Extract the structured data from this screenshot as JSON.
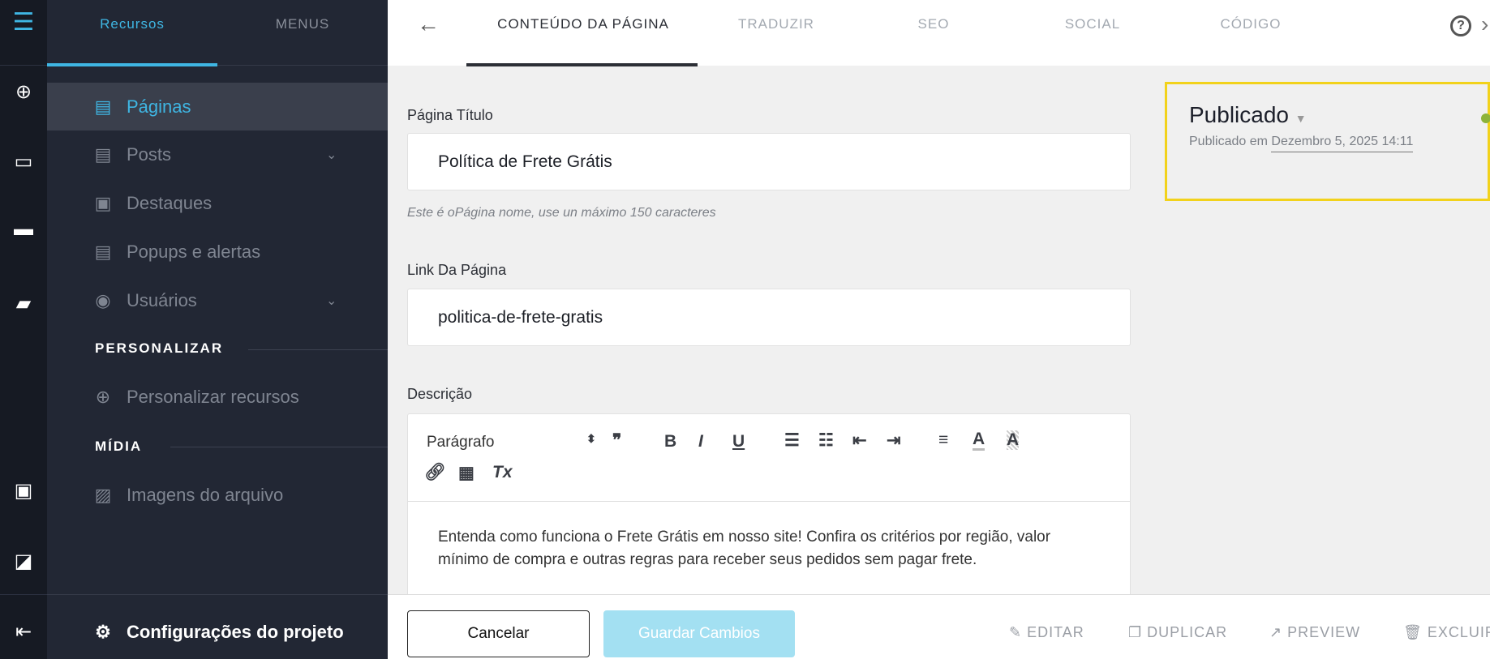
{
  "iconbar": {
    "items": [
      "menu-icon",
      "add-icon",
      "window-icon",
      "board-icon",
      "chat-icon",
      "monitor-icon",
      "note-icon",
      "exit-icon"
    ]
  },
  "sidebar": {
    "tabs": [
      {
        "label": "Recursos"
      },
      {
        "label": "MENUS"
      }
    ],
    "items": [
      {
        "label": "Páginas",
        "icon": "page-icon"
      },
      {
        "label": "Posts",
        "icon": "post-icon"
      },
      {
        "label": "Destaques",
        "icon": "tablet-icon"
      },
      {
        "label": "Popups e alertas",
        "icon": "popup-icon"
      },
      {
        "label": "Usuários",
        "icon": "user-icon"
      }
    ],
    "section_customize": "PERSONALIZAR",
    "customize_item": "Personalizar recursos",
    "section_media": "MÍDIA",
    "media_item": "Imagens do arquivo",
    "footer": "Configurações do projeto"
  },
  "header": {
    "tabs": [
      {
        "label": "CONTEÚDO DA PÁGINA"
      },
      {
        "label": "TRADUZIR"
      },
      {
        "label": "SEO"
      },
      {
        "label": "SOCIAL"
      },
      {
        "label": "CÓDIGO"
      }
    ]
  },
  "form": {
    "title_label": "Página Título",
    "title_value": "Política de Frete Grátis",
    "title_hint": "Este é oPágina nome, use un máximo 150 caracteres",
    "link_label": "Link Da Página",
    "link_value": "politica-de-frete-gratis",
    "desc_label": "Descrição",
    "format_select": "Parágrafo",
    "desc_text": "Entenda como funciona o Frete Grátis em nosso site! Confira os critérios por região, valor mínimo de compra e outras regras para receber seus pedidos sem pagar frete."
  },
  "status": {
    "label": "Publicado",
    "published_prefix": "Publicado em",
    "published_date": "Dezembro 5, 2025 14:11",
    "dot_color": "#8db33a",
    "highlight_color": "#f2d21b"
  },
  "footer": {
    "cancel": "Cancelar",
    "save": "Guardar Cambios",
    "edit": "EDITAR",
    "duplicate": "DUPLICAR",
    "preview": "PREVIEW",
    "delete": "EXCLUIR"
  },
  "colors": {
    "accent": "#3fb6e3",
    "save_bg": "#a3e0f2"
  }
}
